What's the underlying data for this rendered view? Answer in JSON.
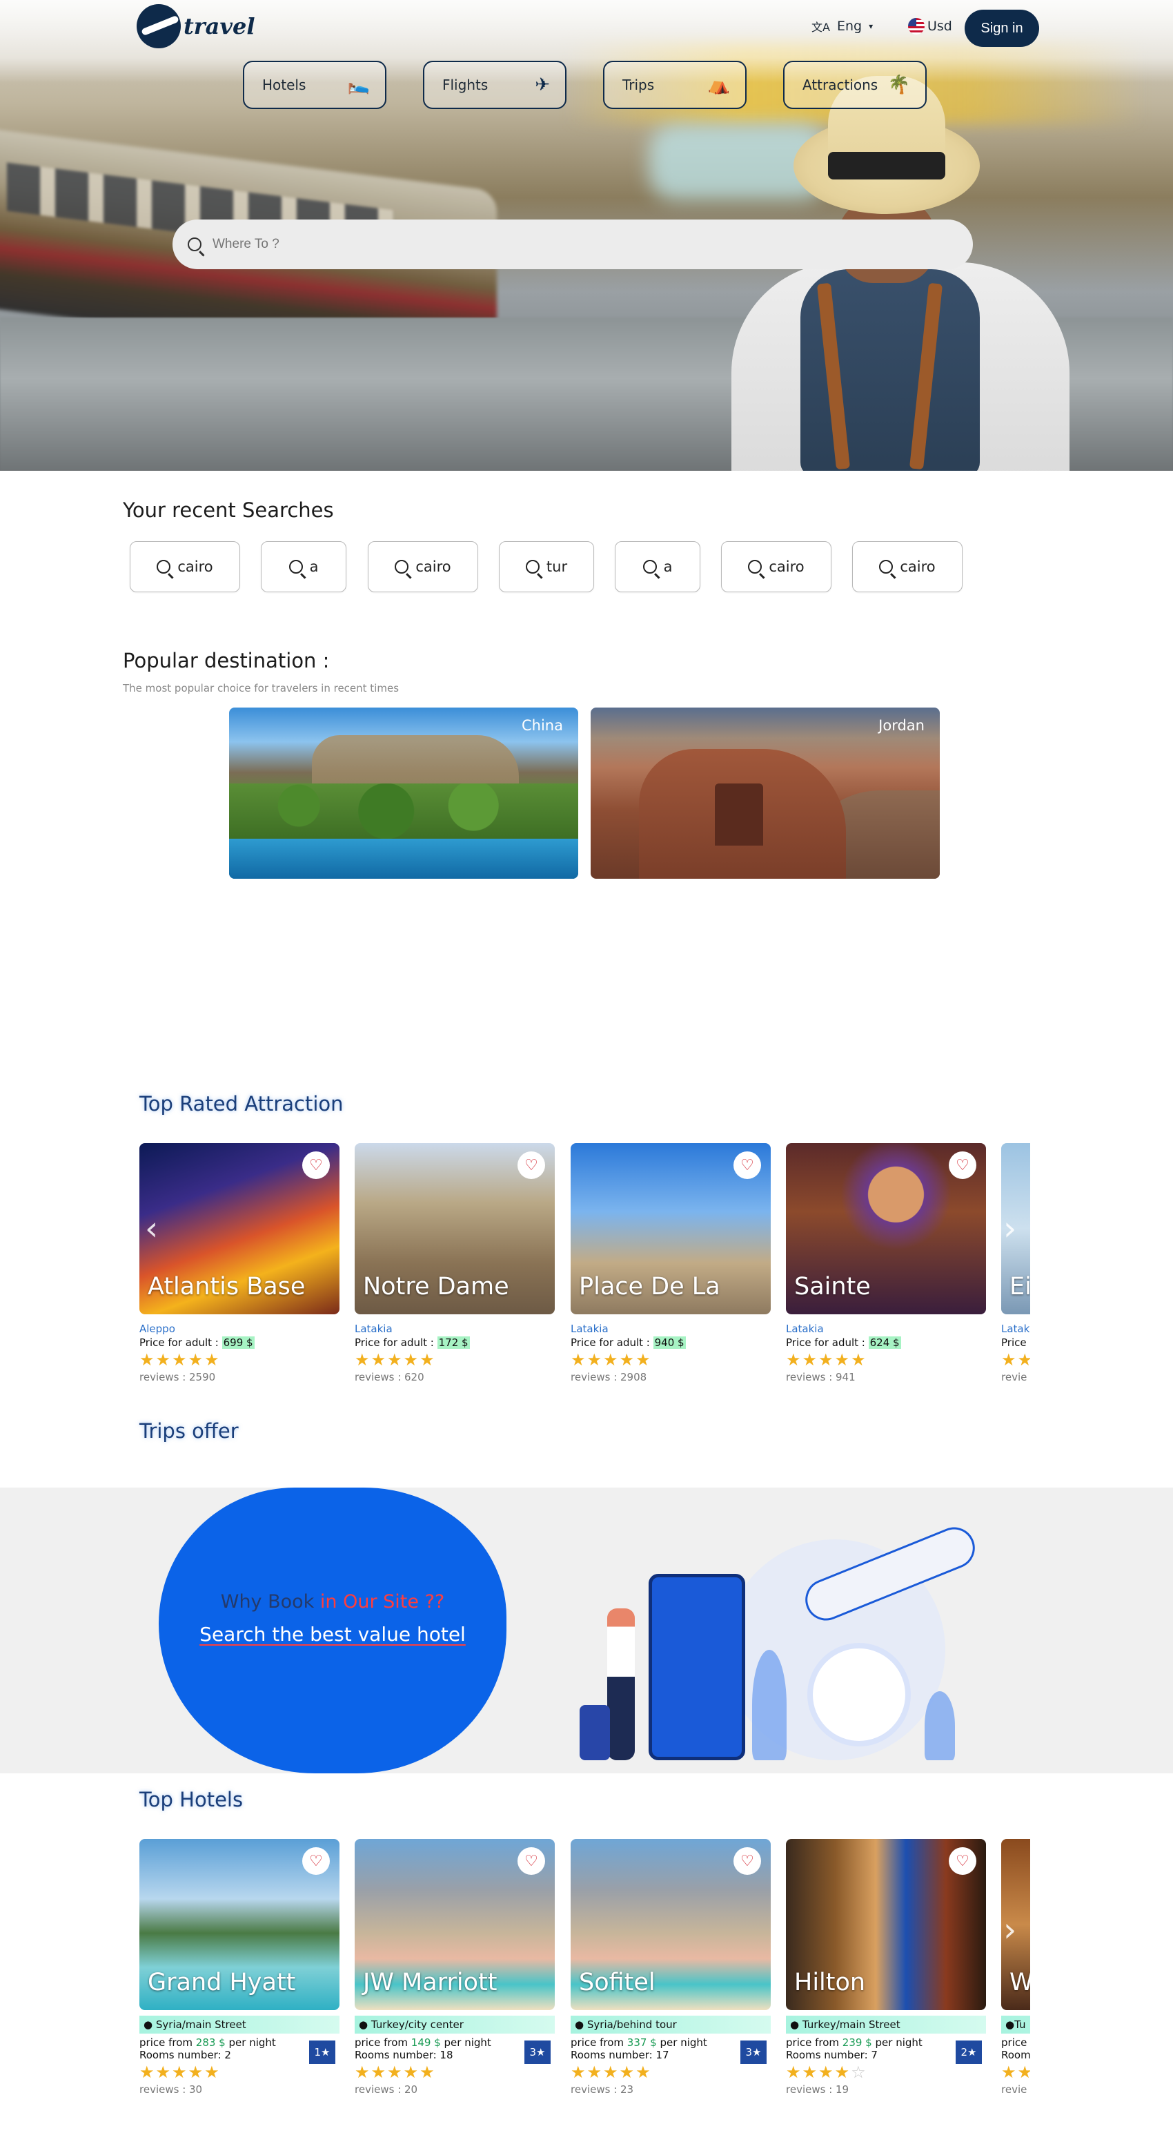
{
  "header": {
    "logo_text": "travel",
    "language_label": "Eng",
    "currency_label": "Usd",
    "signin_label": "Sign in"
  },
  "categories": [
    {
      "label": "Hotels",
      "icon": "bed-icon"
    },
    {
      "label": "Flights",
      "icon": "airplane-icon"
    },
    {
      "label": "Trips",
      "icon": "tent-icon"
    },
    {
      "label": "Attractions",
      "icon": "palm-tree-icon"
    }
  ],
  "search": {
    "placeholder": "Where To ?"
  },
  "recent": {
    "title": "Your recent Searches",
    "items": [
      "cairo",
      "a",
      "cairo",
      "tur",
      "a",
      "cairo",
      "cairo"
    ]
  },
  "popular": {
    "title": "Popular destination :",
    "subtitle": "The most popular choice for travelers in recent times",
    "destinations": [
      "China",
      "Jordan"
    ]
  },
  "attractions": {
    "title": "Top Rated Attraction",
    "items": [
      {
        "name": "Atlantis Base",
        "city": "Aleppo",
        "price_prefix": "Price for adult : ",
        "price": "699 $",
        "rating": 5,
        "reviews": "reviews : 2590"
      },
      {
        "name": "Notre Dame",
        "city": "Latakia",
        "price_prefix": "Price for adult : ",
        "price": "172 $",
        "rating": 5,
        "reviews": "reviews : 620"
      },
      {
        "name": "Place De La",
        "city": "Latakia",
        "price_prefix": "Price for adult : ",
        "price": "940 $",
        "rating": 5,
        "reviews": "reviews : 2908"
      },
      {
        "name": "Sainte",
        "city": "Latakia",
        "price_prefix": "Price for adult : ",
        "price": "624 $",
        "rating": 5,
        "reviews": "reviews : 941"
      },
      {
        "name": "Ei",
        "city": "Latak",
        "price_prefix": "Price",
        "price": "",
        "rating": 5,
        "reviews": "revie"
      }
    ]
  },
  "trips": {
    "title": "Trips offer",
    "why_prefix": "Why Book ",
    "why_highlight": "in Our Site ??",
    "cta": "Search the best value hotel"
  },
  "hotels": {
    "title": "Top Hotels",
    "items": [
      {
        "name": "Grand Hyatt",
        "address": "Syria/main Street",
        "price_prefix": "price from ",
        "price": "283 $",
        "price_suffix": " per night",
        "rooms": "Rooms number: 2",
        "rating": 5,
        "reviews": "reviews : 30",
        "badge": "1★"
      },
      {
        "name": "JW Marriott",
        "address": "Turkey/city center",
        "price_prefix": "price from ",
        "price": "149 $",
        "price_suffix": " per night",
        "rooms": "Rooms number: 18",
        "rating": 5,
        "reviews": "reviews : 20",
        "badge": "3★"
      },
      {
        "name": "Sofitel",
        "address": "Syria/behind tour",
        "price_prefix": "price from ",
        "price": "337 $",
        "price_suffix": " per night",
        "rooms": "Rooms number: 17",
        "rating": 5,
        "reviews": "reviews : 23",
        "badge": "3★"
      },
      {
        "name": "Hilton",
        "address": "Turkey/main Street",
        "price_prefix": "price from ",
        "price": "239 $",
        "price_suffix": " per night",
        "rooms": "Rooms number: 7",
        "rating": 4,
        "reviews": "reviews : 19",
        "badge": "2★"
      },
      {
        "name": "W",
        "address": "Tu",
        "price_prefix": "price",
        "price": "",
        "price_suffix": "",
        "rooms": "Room",
        "rating": 5,
        "reviews": "revie",
        "badge": ""
      }
    ]
  },
  "colors": {
    "brand_navy": "#0e2a4a",
    "cta_blue": "#0b63e8",
    "star_gold": "#f2b01e",
    "heart_red": "#d21f2a"
  }
}
